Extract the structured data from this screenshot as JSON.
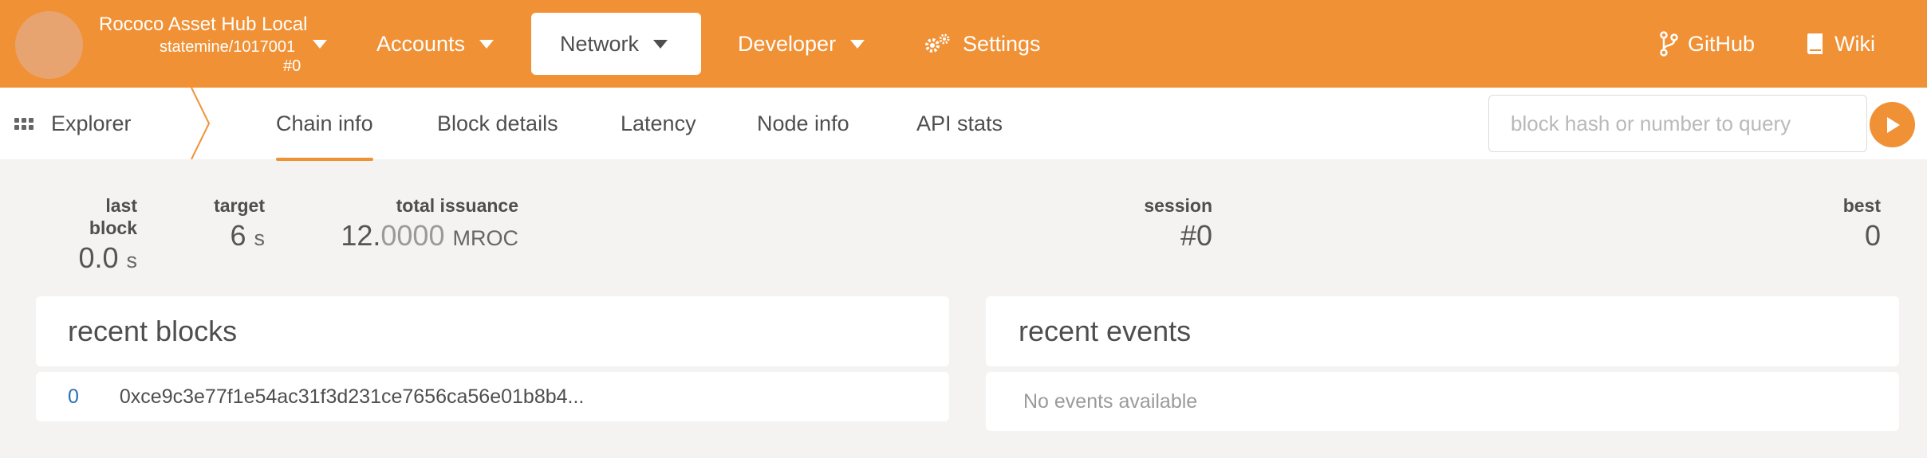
{
  "colors": {
    "accent": "#f19135",
    "link": "#2c6fb5"
  },
  "chain": {
    "name": "Rococo Asset Hub Local",
    "spec": "statemine/1017001",
    "block": "#0"
  },
  "nav": {
    "accounts": "Accounts",
    "network": "Network",
    "developer": "Developer",
    "settings": "Settings",
    "github": "GitHub",
    "wiki": "Wiki"
  },
  "subnav": {
    "section": "Explorer",
    "tabs": [
      "Chain info",
      "Block details",
      "Latency",
      "Node info",
      "API stats"
    ],
    "active_tab": "Chain info",
    "search_placeholder": "block hash or number to query"
  },
  "summary": {
    "last_block": {
      "label": "last block",
      "value": "0.0",
      "unit": "s"
    },
    "target": {
      "label": "target",
      "value": "6",
      "unit": "s"
    },
    "total_issuance": {
      "label": "total issuance",
      "value_main": "12.",
      "value_faint": "0000",
      "unit": "MROC"
    },
    "session": {
      "label": "session",
      "value": "#0"
    },
    "best": {
      "label": "best",
      "value": "0"
    }
  },
  "recent_blocks": {
    "title": "recent blocks",
    "rows": [
      {
        "number": "0",
        "hash": "0xce9c3e77f1e54ac31f3d231ce7656ca56e01b8b4..."
      }
    ]
  },
  "recent_events": {
    "title": "recent events",
    "empty": "No events available"
  },
  "icons": [
    "chain-logo",
    "caret-down-icon",
    "gear-icon",
    "git-branch-icon",
    "book-icon",
    "apps-grid-icon",
    "play-icon"
  ]
}
